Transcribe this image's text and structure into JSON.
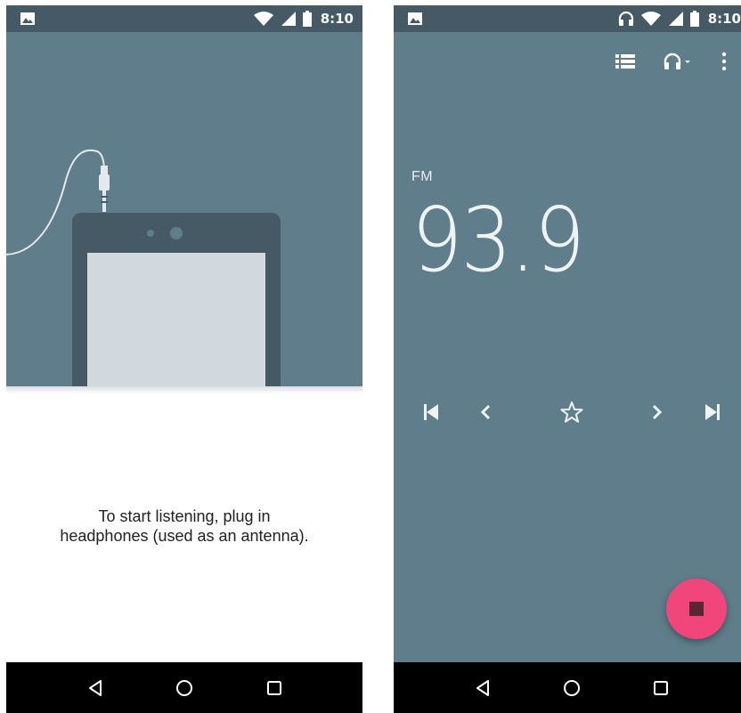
{
  "left_screen": {
    "status_bar": {
      "time": "8:10",
      "icons": [
        "image-icon",
        "wifi-icon",
        "signal-icon",
        "battery-icon"
      ]
    },
    "illustration": {
      "description_icon": "phone-with-headphone-plug-illustration"
    },
    "message_lines": [
      "To start listening, plug in",
      "headphones (used as an antenna)."
    ],
    "nav_bar": {
      "icons": [
        "back-icon",
        "home-icon",
        "recents-icon"
      ]
    }
  },
  "right_screen": {
    "status_bar": {
      "time": "8:10",
      "icons": [
        "image-icon",
        "headset-icon",
        "wifi-icon",
        "signal-icon",
        "battery-icon"
      ]
    },
    "toolbar": {
      "icons": [
        "station-list-icon",
        "audio-output-icon",
        "more-vert-icon"
      ]
    },
    "band": "FM",
    "frequency": "93.9",
    "controls": [
      "skip-previous-icon",
      "seek-back-icon",
      "favorite-star-icon",
      "seek-forward-icon",
      "skip-next-icon"
    ],
    "fab": {
      "icon": "stop-icon",
      "color": "#f0467b"
    },
    "nav_bar": {
      "icons": [
        "back-icon",
        "home-icon",
        "recents-icon"
      ]
    }
  },
  "colors": {
    "status_bar": "#455a64",
    "primary": "#607d8b",
    "accent": "#f0467b",
    "nav_bar": "#000000"
  }
}
